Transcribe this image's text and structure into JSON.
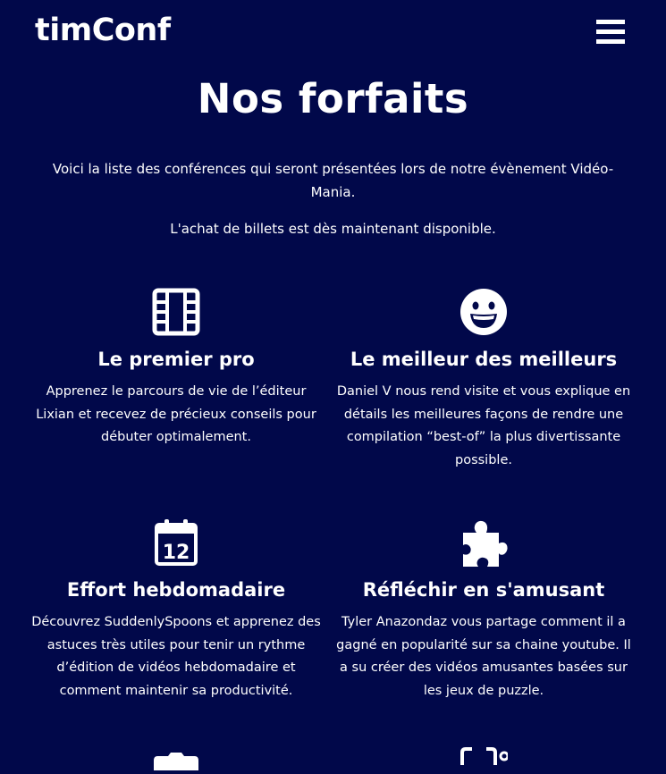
{
  "header": {
    "logo": "timConf",
    "menu_icon": "hamburger-menu-icon"
  },
  "main": {
    "title": "Nos forfaits",
    "intro_text": "Voici la liste des conférences qui seront présentées lors de notre évènement Vidéo-Mania.",
    "intro_subtext": "L'achat de billets est dès maintenant disponible."
  },
  "cards": [
    {
      "icon": "film-icon",
      "title": "Le premier pro",
      "description": "Apprenez le parcours de vie de l’éditeur Lixian et recevez de précieux conseils pour débuter optimalement."
    },
    {
      "icon": "grin-face-icon",
      "title": "Le meilleur des meilleurs",
      "description": "Daniel V nous rend visite et vous explique en détails les meilleures façons de rendre une compilation “best-of” la plus divertissante possible."
    },
    {
      "icon": "calendar-icon",
      "calendar_day": "12",
      "title": "Effort hebdomadaire",
      "description": "Découvrez SuddenlySpoons et apprenez des astuces très utiles pour tenir un rythme d’édition de vidéos hebdomadaire et comment maintenir sa productivité."
    },
    {
      "icon": "puzzle-piece-icon",
      "title": "Réfléchir en s'amusant",
      "description": "Tyler Anazondaz vous partage comment il a gagné en popularité sur sa chaine youtube. Il a su créer des vidéos amusantes basées sur les jeux de puzzle."
    },
    {
      "icon": "camera-icon"
    },
    {
      "icon": "video-camera-icon"
    }
  ]
}
